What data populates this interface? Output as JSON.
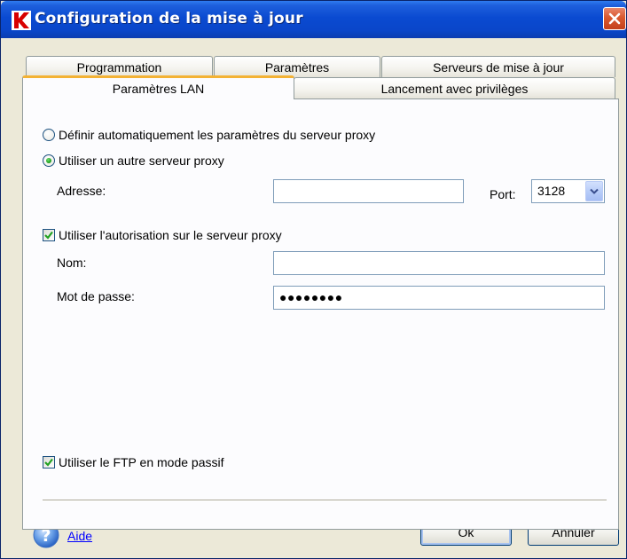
{
  "window": {
    "title": "Configuration de la mise à jour"
  },
  "tabs": {
    "row1": [
      {
        "label": "Programmation"
      },
      {
        "label": "Paramètres"
      },
      {
        "label": "Serveurs de mise à jour"
      }
    ],
    "row2": [
      {
        "label": "Paramètres LAN",
        "active": true
      },
      {
        "label": "Lancement avec privilèges",
        "active": false
      }
    ]
  },
  "proxy": {
    "auto_label": "Définir automatiquement les paramètres du serveur proxy",
    "auto_selected": false,
    "manual_label": "Utiliser un autre serveur proxy",
    "manual_selected": true,
    "address_label": "Adresse:",
    "address_value": "",
    "port_label": "Port:",
    "port_value": "3128"
  },
  "auth": {
    "checkbox_label": "Utiliser l'autorisation sur le serveur proxy",
    "checked": true,
    "name_label": "Nom:",
    "name_value": "",
    "password_label": "Mot de passe:",
    "password_value": "●●●●●●●●"
  },
  "ftp": {
    "checkbox_label": "Utiliser le FTP en mode passif",
    "checked": true
  },
  "footer": {
    "help_label": "Aide",
    "ok_label": "Ok",
    "cancel_label": "Annuler"
  },
  "colors": {
    "titlebar": "#0a4ad1",
    "active_tab_accent": "#f3b234",
    "close_button": "#d9592f",
    "link": "#0000ff"
  }
}
